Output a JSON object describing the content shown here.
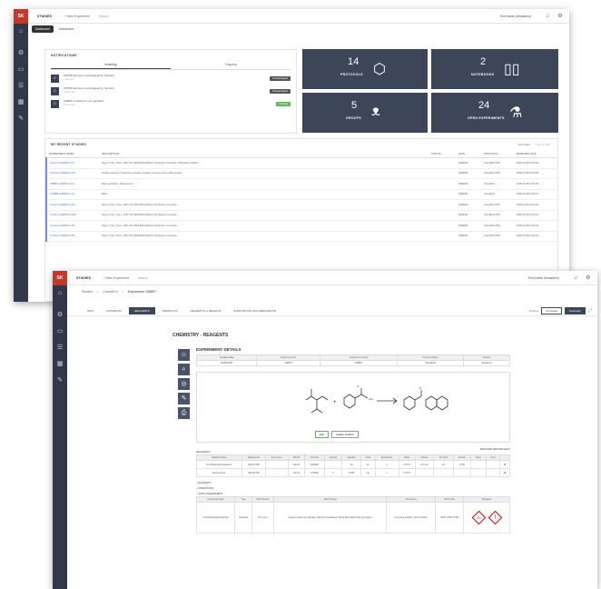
{
  "window1": {
    "app_title": "STUDIES",
    "new_experiment": "+ New Experiment",
    "search_placeholder": "Search",
    "user": "Test Admin (testadmin)",
    "tooltip": "Dashboard",
    "crumb": "Dashboard",
    "notifications": {
      "title": "NOTIFICATIONS",
      "tabs": [
        "Incoming",
        "Outgoing"
      ],
      "items": [
        {
          "initial": "C",
          "text": "108788 has been countersigned by chemist1",
          "time": "1 hour ago",
          "badge": "Countersigned"
        },
        {
          "initial": "C",
          "text": "108789 has been countersigned by chemist1",
          "time": "2 hours ago",
          "badge": "Countersigned"
        },
        {
          "initial": "C",
          "text": "108809 is waiting for your signature",
          "time": "3 hours ago",
          "badge": "Pending"
        }
      ]
    },
    "tiles": [
      {
        "num": "14",
        "label": "PROTOCOLS",
        "icon": "cube-icon"
      },
      {
        "num": "2",
        "label": "NOTEBOOKS",
        "icon": "book-icon"
      },
      {
        "num": "5",
        "label": "GROUPS",
        "icon": "group-icon"
      },
      {
        "num": "24",
        "label": "OPEN EXPERIMENTS",
        "icon": "flask-icon"
      }
    ],
    "recent": {
      "title": "MY RECENT STUDIES",
      "grid_view": "Grid View",
      "type_filter": "Type to filter",
      "columns": [
        "EXPERIMENT NAME",
        "DESCRIPTION",
        "STATUS",
        "DATE",
        "PROTOCOL",
        "MODIFIED DATE"
      ],
      "rows": [
        {
          "name": "Loureiro CHEMICA (17)",
          "desc": "Step 3 | Org. Chem. 1994, 59, 8196-8204 Efficient Synthesis of Lourdes, A Reaction Inhibitor...",
          "status": "",
          "date": "##/##/##",
          "protocol": "ChemELN PPH",
          "modified": "2018-03-08 13:00:00"
        },
        {
          "name": "Perforins CHEMICA (17)",
          "desc": "Simple example of reductive amination reaction forming an aryl-(alkyl) amine...",
          "status": "",
          "date": "##/##/##",
          "protocol": "ChemELN PPH",
          "modified": "2018-03-08 13:09:08"
        },
        {
          "name": "CMBB7 CHEMICA (15)",
          "desc": "Basic synthesis - Experiment 1",
          "status": "",
          "date": "##/##/##",
          "protocol": "ChemELN",
          "modified": "2018-03-08 13:07:45"
        },
        {
          "name": "LOMBB CHEMICA (14)",
          "desc": "Basic",
          "status": "",
          "date": "##/##/##",
          "protocol": "ChemELN",
          "modified": "2018-03-08 13:05:14"
        },
        {
          "name": "Loureiro CHEMICA (111)",
          "desc": "Step 3 | Org. Chem. 1994, 59, 8196-8204 Efficient Synthesis of Lourdes...",
          "status": "",
          "date": "##/##/##",
          "protocol": "ChemELN PPH",
          "modified": "2018-03-08 13:04:44"
        },
        {
          "name": "Loureiro CHEMICA (110)",
          "desc": "Step 3 | Org. Chem. 1994, 59, 8196-8204 Efficient Synthesis of Lourdes...",
          "status": "",
          "date": "##/##/##",
          "protocol": "ChemELN PPH",
          "modified": "2018-03-08 13:03:24"
        },
        {
          "name": "Loureiro CHEMICA (19)",
          "desc": "Step 3 | Org. Chem. 1994, 59, 8196-8204 Efficient Synthesis of Lourdes...",
          "status": "",
          "date": "##/##/##",
          "protocol": "ChemELN PPH",
          "modified": "2018-03-08 13:02:04"
        },
        {
          "name": "Loureiro CHEMICA (18)",
          "desc": "Step 3 | Org. Chem. 1994, 59, 8196-8204 Efficient Synthesis of Lourdes...",
          "status": "",
          "date": "##/##/##",
          "protocol": "ChemELN PPH",
          "modified": "2018-03-08 13:00:44"
        }
      ]
    }
  },
  "window2": {
    "app_title": "STUDIES",
    "new_experiment": "+ New Experiment",
    "search_placeholder": "Search",
    "user": "Test Admin (testadmin)",
    "breadcrumb": [
      "Studies",
      "ChemELN",
      "Experiment 108807"
    ],
    "tabs": [
      "INFO",
      "NOTEBOOK",
      "REAGENTS",
      "PRODUCTS",
      "REAGENTS & RESULTS",
      "SUPPORTING DOCUMENTATION"
    ],
    "right_controls": {
      "options": "Options",
      "complete": "Complete",
      "summary": "Summary"
    },
    "doc_title": "CHEMISTRY - REAGENTS",
    "details_title": "EXPERIMENT DETAILS",
    "details_headers": [
      "Created Date",
      "Experiment ID",
      "Experiment Name",
      "Protocol Name",
      "Creator"
    ],
    "details_values": [
      "06/03/2018",
      "108807",
      "108807",
      "ChemELN",
      "testadmin"
    ],
    "reaction_buttons": [
      "Edit",
      "Update Scaffold"
    ],
    "reagents_title": "REAGENTS",
    "reagents_add": "REGISTER NEW REAGENT",
    "reagent_headers": [
      "Reactant Name",
      "Reactant ID",
      "Fore Layer",
      "Mol Wt",
      "Formula",
      "Limiting",
      "Quantity",
      "Units",
      "Equivalents",
      "Moles",
      "Volume",
      "Vol Units",
      "Density",
      "Purity",
      "Conc"
    ],
    "reagent_rows": [
      [
        "N,N-Diisopropylethylamine",
        "(M)-617765",
        "...",
        "129.24",
        "C8H19N",
        "",
        "10",
        "mL",
        "1",
        "0.0774",
        "10.0 mL",
        "mL",
        "0.755",
        "",
        ""
      ],
      [
        "Benzoic Acid",
        "(M)-617763",
        "...",
        "122.12",
        "C7H6O2",
        "X",
        "9.456",
        "mg",
        "1",
        "0.0774",
        "",
        "",
        "",
        "",
        ""
      ]
    ],
    "sections": [
      "SOLVENTS",
      "CONDITIONS",
      "RISK ASSESSMENT"
    ],
    "risk_headers": [
      "Compound Name",
      "Type",
      "SDS Number",
      "Risk Phrases",
      "Description",
      "GHS Code",
      "Pictogram"
    ],
    "risk_rows": [
      [
        "N,N-Diisopropylethylamine",
        "Reactant",
        "SDS sds-1",
        "Causes serious eye damage. Harmful if swallowed. Highly flammable liquid and vapour.",
        "Low-acute lethality; toxic if inhaled.",
        "H225, H302, H318",
        ""
      ]
    ]
  }
}
